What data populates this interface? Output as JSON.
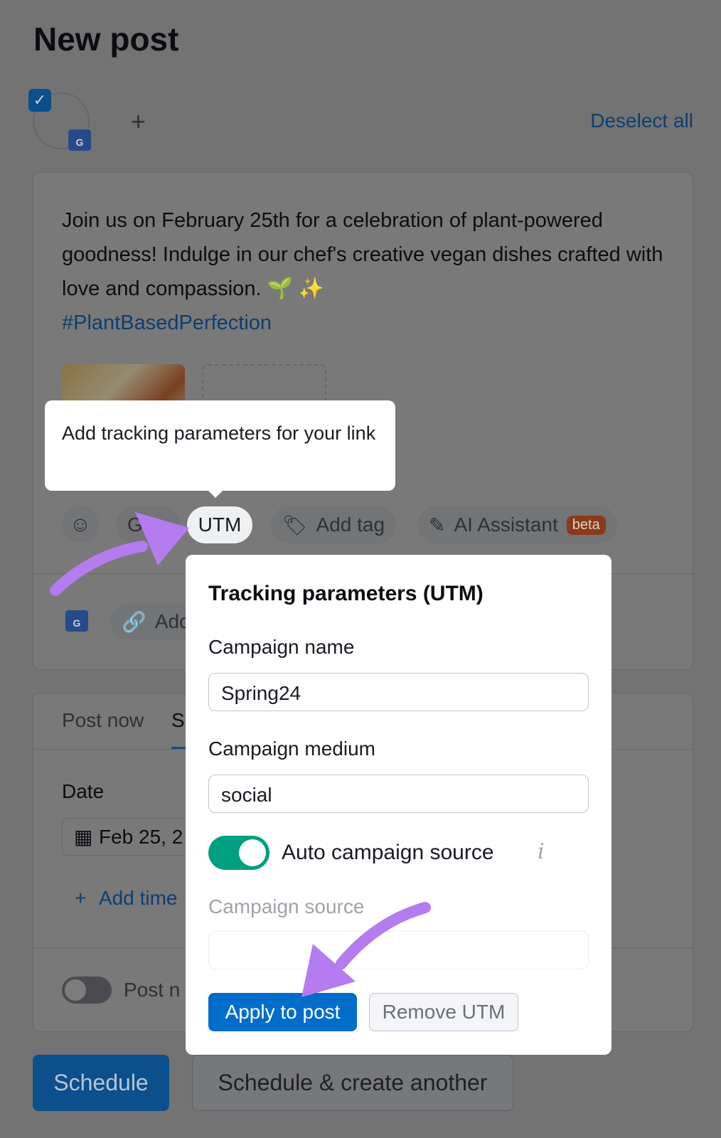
{
  "header": {
    "title": "New post",
    "add_label": "+",
    "deselect_all": "Deselect all"
  },
  "post": {
    "text": "Join us on February 25th for a celebration of plant-powered goodness! Indulge in our chef's creative vegan dishes crafted with love and compassion. 🌱 ✨",
    "hashtag": "#PlantBasedPerfection"
  },
  "toolbar": {
    "gif_label": "GI",
    "utm_label": "UTM",
    "add_tag_label": "Add tag",
    "ai_label": "AI Assistant",
    "ai_badge": "beta"
  },
  "link_row": {
    "add_link_label": "Add"
  },
  "schedule_card": {
    "tabs": [
      "Post now",
      "S"
    ],
    "date_label": "Date",
    "date_value": "Feb 25, 2",
    "add_time": "Add time",
    "post_now_toggle_label": "Post n"
  },
  "footer": {
    "schedule": "Schedule",
    "schedule_another": "Schedule & create another"
  },
  "tooltip": {
    "text": "Add tracking parameters for your link"
  },
  "utm_popup": {
    "title": "Tracking parameters (UTM)",
    "campaign_name_label": "Campaign name",
    "campaign_name_value": "Spring24",
    "campaign_medium_label": "Campaign medium",
    "campaign_medium_value": "social",
    "auto_source_label": "Auto campaign source",
    "auto_source_on": true,
    "campaign_source_label": "Campaign source",
    "campaign_source_value": "",
    "apply": "Apply to post",
    "remove": "Remove UTM"
  },
  "colors": {
    "primary": "#006dca",
    "toggle_on": "#009f81",
    "arrow": "#b57cf0",
    "badge": "#e0521f"
  }
}
